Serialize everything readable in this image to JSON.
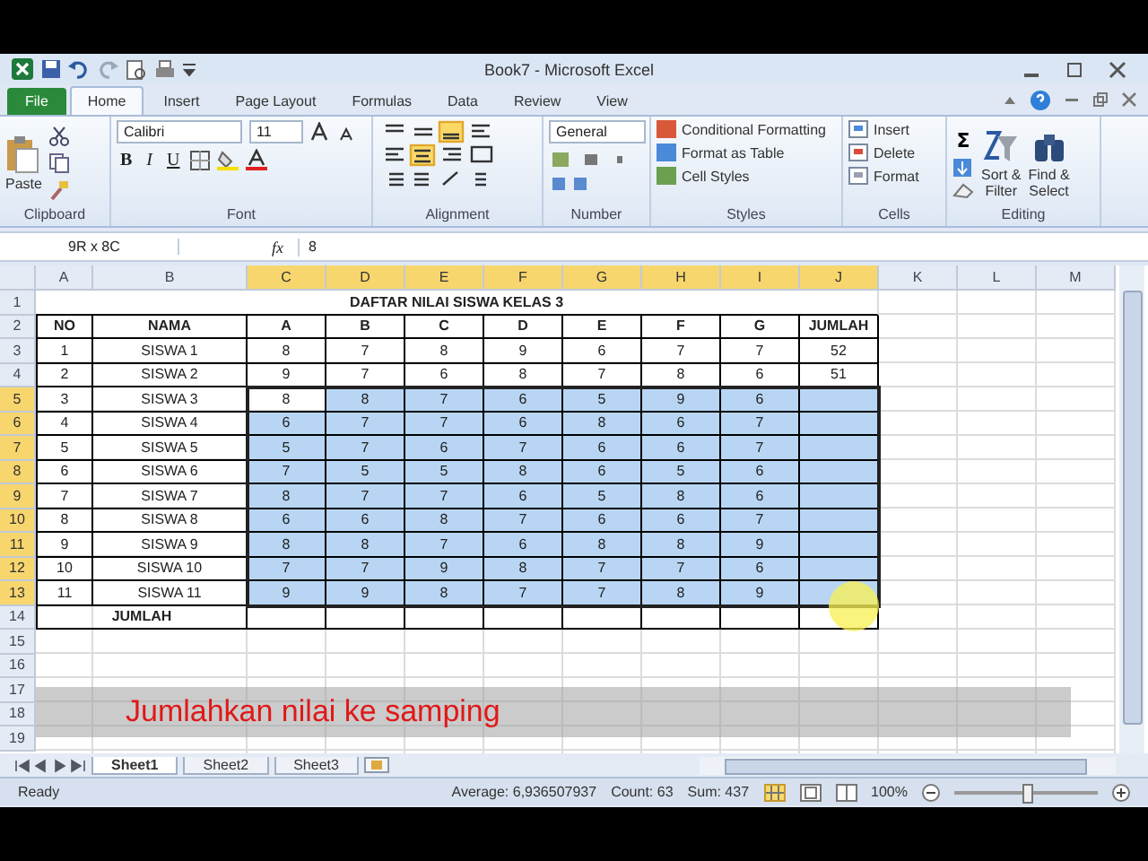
{
  "window": {
    "title": "Book7 - Microsoft Excel"
  },
  "ribbon_tabs": [
    {
      "label": "File",
      "kind": "file",
      "selected": false
    },
    {
      "label": "Home",
      "kind": "tab",
      "selected": true
    },
    {
      "label": "Insert",
      "kind": "tab",
      "selected": false
    },
    {
      "label": "Page Layout",
      "kind": "tab",
      "selected": false
    },
    {
      "label": "Formulas",
      "kind": "tab",
      "selected": false
    },
    {
      "label": "Data",
      "kind": "tab",
      "selected": false
    },
    {
      "label": "Review",
      "kind": "tab",
      "selected": false
    },
    {
      "label": "View",
      "kind": "tab",
      "selected": false
    }
  ],
  "clipboard": {
    "label": "Clipboard",
    "paste": "Paste"
  },
  "font": {
    "label": "Font",
    "name": "Calibri",
    "size": "11",
    "styles": [
      "B",
      "I",
      "U"
    ]
  },
  "alignment": {
    "label": "Alignment"
  },
  "number": {
    "label": "Number",
    "format": "General"
  },
  "styles": {
    "label": "Styles",
    "items": [
      "Conditional Formatting",
      "Format as Table",
      "Cell Styles"
    ]
  },
  "cells": {
    "label": "Cells",
    "items": [
      "Insert",
      "Delete",
      "Format"
    ]
  },
  "editing": {
    "label": "Editing",
    "autosum": "Σ",
    "sort": [
      "Sort &",
      "Filter"
    ],
    "find": [
      "Find &",
      "Select"
    ]
  },
  "formula_bar": {
    "name_box": "9R x 8C",
    "function_label": "fx",
    "formula": "8"
  },
  "sheet": {
    "columns": [
      {
        "label": "A",
        "selected": false
      },
      {
        "label": "B",
        "selected": false
      },
      {
        "label": "C",
        "selected": true
      },
      {
        "label": "D",
        "selected": true
      },
      {
        "label": "E",
        "selected": true
      },
      {
        "label": "F",
        "selected": true
      },
      {
        "label": "G",
        "selected": true
      },
      {
        "label": "H",
        "selected": true
      },
      {
        "label": "I",
        "selected": true
      },
      {
        "label": "J",
        "selected": true
      },
      {
        "label": "K",
        "selected": false
      },
      {
        "label": "L",
        "selected": false
      },
      {
        "label": "M",
        "selected": false
      }
    ],
    "rows": [
      {
        "header": "1",
        "kind": "title",
        "selected": false,
        "title": "DAFTAR NILAI SISWA KELAS 3"
      },
      {
        "header": "2",
        "kind": "head",
        "selected": false,
        "cells": [
          "NO",
          "NAMA",
          "A",
          "B",
          "C",
          "D",
          "E",
          "F",
          "G",
          "JUMLAH"
        ]
      },
      {
        "header": "3",
        "kind": "data",
        "selected": false,
        "cells": [
          {
            "text": "1",
            "selected": false
          },
          {
            "text": "SISWA 1",
            "selected": false
          },
          {
            "text": "8",
            "selected": false
          },
          {
            "text": "7",
            "selected": false
          },
          {
            "text": "8",
            "selected": false
          },
          {
            "text": "9",
            "selected": false
          },
          {
            "text": "6",
            "selected": false
          },
          {
            "text": "7",
            "selected": false
          },
          {
            "text": "7",
            "selected": false
          },
          {
            "text": "52",
            "selected": false
          }
        ]
      },
      {
        "header": "4",
        "kind": "data",
        "selected": false,
        "cells": [
          {
            "text": "2",
            "selected": false
          },
          {
            "text": "SISWA 2",
            "selected": false
          },
          {
            "text": "9",
            "selected": false
          },
          {
            "text": "7",
            "selected": false
          },
          {
            "text": "6",
            "selected": false
          },
          {
            "text": "8",
            "selected": false
          },
          {
            "text": "7",
            "selected": false
          },
          {
            "text": "8",
            "selected": false
          },
          {
            "text": "6",
            "selected": false
          },
          {
            "text": "51",
            "selected": false
          }
        ]
      },
      {
        "header": "5",
        "kind": "data",
        "selected": true,
        "cells": [
          {
            "text": "3",
            "selected": false
          },
          {
            "text": "SISWA 3",
            "selected": false
          },
          {
            "text": "8",
            "selected": false
          },
          {
            "text": "8",
            "selected": true
          },
          {
            "text": "7",
            "selected": true
          },
          {
            "text": "6",
            "selected": true
          },
          {
            "text": "5",
            "selected": true
          },
          {
            "text": "9",
            "selected": true
          },
          {
            "text": "6",
            "selected": true
          },
          {
            "selected": true
          }
        ]
      },
      {
        "header": "6",
        "kind": "data",
        "selected": true,
        "cells": [
          {
            "text": "4",
            "selected": false
          },
          {
            "text": "SISWA 4",
            "selected": false
          },
          {
            "text": "6",
            "selected": true
          },
          {
            "text": "7",
            "selected": true
          },
          {
            "text": "7",
            "selected": true
          },
          {
            "text": "6",
            "selected": true
          },
          {
            "text": "8",
            "selected": true
          },
          {
            "text": "6",
            "selected": true
          },
          {
            "text": "7",
            "selected": true
          },
          {
            "selected": true
          }
        ]
      },
      {
        "header": "7",
        "kind": "data",
        "selected": true,
        "cells": [
          {
            "text": "5",
            "selected": false
          },
          {
            "text": "SISWA 5",
            "selected": false
          },
          {
            "text": "5",
            "selected": true
          },
          {
            "text": "7",
            "selected": true
          },
          {
            "text": "6",
            "selected": true
          },
          {
            "text": "7",
            "selected": true
          },
          {
            "text": "6",
            "selected": true
          },
          {
            "text": "6",
            "selected": true
          },
          {
            "text": "7",
            "selected": true
          },
          {
            "selected": true
          }
        ]
      },
      {
        "header": "8",
        "kind": "data",
        "selected": true,
        "cells": [
          {
            "text": "6",
            "selected": false
          },
          {
            "text": "SISWA 6",
            "selected": false
          },
          {
            "text": "7",
            "selected": true
          },
          {
            "text": "5",
            "selected": true
          },
          {
            "text": "5",
            "selected": true
          },
          {
            "text": "8",
            "selected": true
          },
          {
            "text": "6",
            "selected": true
          },
          {
            "text": "5",
            "selected": true
          },
          {
            "text": "6",
            "selected": true
          },
          {
            "selected": true
          }
        ]
      },
      {
        "header": "9",
        "kind": "data",
        "selected": true,
        "cells": [
          {
            "text": "7",
            "selected": false
          },
          {
            "text": "SISWA 7",
            "selected": false
          },
          {
            "text": "8",
            "selected": true
          },
          {
            "text": "7",
            "selected": true
          },
          {
            "text": "7",
            "selected": true
          },
          {
            "text": "6",
            "selected": true
          },
          {
            "text": "5",
            "selected": true
          },
          {
            "text": "8",
            "selected": true
          },
          {
            "text": "6",
            "selected": true
          },
          {
            "selected": true
          }
        ]
      },
      {
        "header": "10",
        "kind": "data",
        "selected": true,
        "cells": [
          {
            "text": "8",
            "selected": false
          },
          {
            "text": "SISWA 8",
            "selected": false
          },
          {
            "text": "6",
            "selected": true
          },
          {
            "text": "6",
            "selected": true
          },
          {
            "text": "8",
            "selected": true
          },
          {
            "text": "7",
            "selected": true
          },
          {
            "text": "6",
            "selected": true
          },
          {
            "text": "6",
            "selected": true
          },
          {
            "text": "7",
            "selected": true
          },
          {
            "selected": true
          }
        ]
      },
      {
        "header": "11",
        "kind": "data",
        "selected": true,
        "cells": [
          {
            "text": "9",
            "selected": false
          },
          {
            "text": "SISWA 9",
            "selected": false
          },
          {
            "text": "8",
            "selected": true
          },
          {
            "text": "8",
            "selected": true
          },
          {
            "text": "7",
            "selected": true
          },
          {
            "text": "6",
            "selected": true
          },
          {
            "text": "8",
            "selected": true
          },
          {
            "text": "8",
            "selected": true
          },
          {
            "text": "9",
            "selected": true
          },
          {
            "selected": true
          }
        ]
      },
      {
        "header": "12",
        "kind": "data",
        "selected": true,
        "cells": [
          {
            "text": "10",
            "selected": false
          },
          {
            "text": "SISWA 10",
            "selected": false
          },
          {
            "text": "7",
            "selected": true
          },
          {
            "text": "7",
            "selected": true
          },
          {
            "text": "9",
            "selected": true
          },
          {
            "text": "8",
            "selected": true
          },
          {
            "text": "7",
            "selected": true
          },
          {
            "text": "7",
            "selected": true
          },
          {
            "text": "6",
            "selected": true
          },
          {
            "selected": true
          }
        ]
      },
      {
        "header": "13",
        "kind": "data",
        "selected": true,
        "cells": [
          {
            "text": "11",
            "selected": false
          },
          {
            "text": "SISWA 11",
            "selected": false
          },
          {
            "text": "9",
            "selected": true
          },
          {
            "text": "9",
            "selected": true
          },
          {
            "text": "8",
            "selected": true
          },
          {
            "text": "7",
            "selected": true
          },
          {
            "text": "7",
            "selected": true
          },
          {
            "text": "8",
            "selected": true
          },
          {
            "text": "9",
            "selected": true
          },
          {
            "selected": true
          }
        ]
      },
      {
        "header": "14",
        "kind": "total",
        "selected": false,
        "label": "JUMLAH"
      },
      {
        "header": "15",
        "kind": "empty",
        "selected": false
      },
      {
        "header": "16",
        "kind": "empty",
        "selected": false
      },
      {
        "header": "17",
        "kind": "empty",
        "selected": false
      },
      {
        "header": "18",
        "kind": "empty",
        "selected": false
      },
      {
        "header": "19",
        "kind": "empty",
        "selected": false
      }
    ]
  },
  "sheet_tabs": [
    {
      "label": "Sheet1",
      "selected": true
    },
    {
      "label": "Sheet2",
      "selected": false
    },
    {
      "label": "Sheet3",
      "selected": false
    }
  ],
  "status_bar": {
    "status": "Ready",
    "average": "Average: 6,936507937",
    "count": "Count: 63",
    "sum": "Sum: 437",
    "zoom": "100%",
    "zoom_level": {
      "level": 0.5
    }
  },
  "caption": "Jumlahkan nilai ke samping"
}
